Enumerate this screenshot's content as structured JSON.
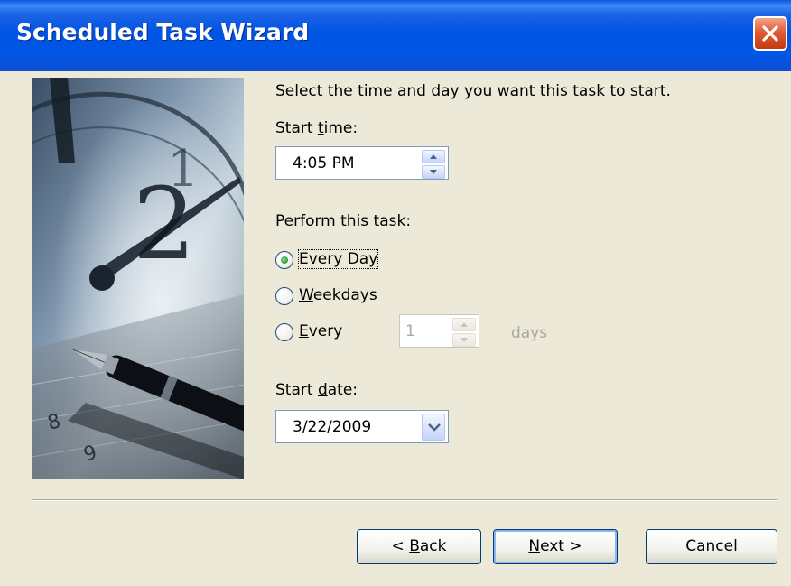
{
  "window": {
    "title": "Scheduled Task Wizard",
    "close_icon": "close-icon"
  },
  "prompt": "Select the time and day you want this task to start.",
  "start_time": {
    "label_pre": "Start ",
    "label_mnemonic": "t",
    "label_post": "ime:",
    "value": "4:05 PM"
  },
  "perform": {
    "label": "Perform this task:",
    "options": [
      {
        "pre": "",
        "mnemonic": "",
        "text": "Every Day",
        "selected": true
      },
      {
        "pre": "",
        "mnemonic": "W",
        "text": "eekdays",
        "selected": false
      },
      {
        "pre": "",
        "mnemonic": "E",
        "text": "very",
        "selected": false
      }
    ],
    "every_days_value": "1",
    "days_label": "days"
  },
  "start_date": {
    "label_pre": "Start ",
    "label_mnemonic": "d",
    "label_post": "ate:",
    "value": "3/22/2009"
  },
  "buttons": {
    "back_pre": "< ",
    "back_mnemonic": "B",
    "back_post": "ack",
    "next_mnemonic": "N",
    "next_post": "ext >",
    "cancel": "Cancel"
  },
  "colors": {
    "titlebar": "#0054e3",
    "dialog_bg": "#ece9d8",
    "close_button": "#e25b33",
    "radio_selected": "#35a53f"
  }
}
